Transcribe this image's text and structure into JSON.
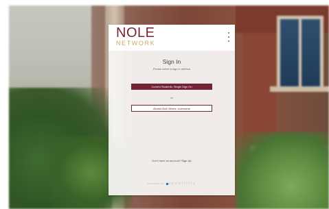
{
  "logo": {
    "line1": "NOLE",
    "line2": "NETWORK"
  },
  "menu": {
    "icon": "kebab-menu-icon"
  },
  "signin": {
    "title": "Sign In",
    "subtitle": "Please select a sign in method",
    "primary_button": "Current Students: Single Sign On",
    "or_label": "or",
    "secondary_button": "Alumni And Others: Username"
  },
  "signup": {
    "prompt": "Don't have an account?",
    "link": "Sign Up"
  },
  "footer": {
    "powered_by": "POWERED BY",
    "brand": "symplicity"
  },
  "colors": {
    "accent": "#732434",
    "gold": "#c8a866"
  }
}
